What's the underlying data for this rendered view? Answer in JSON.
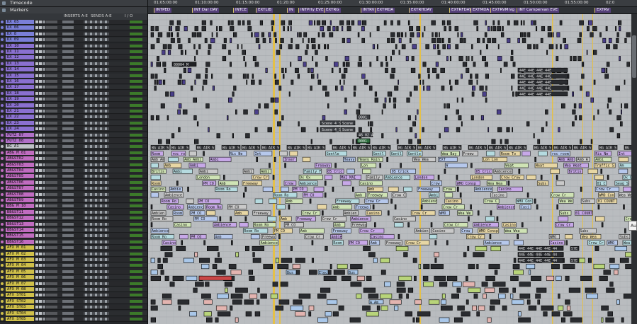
{
  "header": {
    "timecode_label": "Timecode",
    "markers_label": "Markers"
  },
  "columns": {
    "inserts": "INSERTS A-E",
    "sends": "SENDS A-E",
    "io": "I / O"
  },
  "ruler_times": [
    "01:05:00:00",
    "01:10:00:00",
    "01:15:00:00",
    "01:20:00",
    "01:25:00:00",
    "01:30:00:00",
    "01:35:00:00",
    "01:40:00:00",
    "01:45:00:00",
    "01:50:00:00",
    "01:55:00:00",
    "02:0"
  ],
  "markers": [
    "INTPED",
    "INT Dar DAY",
    "INTCE",
    "EXTLIB",
    "IN",
    "INTPrty EVE",
    "EXTRG",
    "INTRV",
    "EXTMDA",
    "EXTRHDAY",
    "EXTRFDAY",
    "EXTMDA",
    "EXTRVMnig",
    "INT Campervan EVE",
    "EXTRV"
  ],
  "tracks": [
    {
      "name": "DX 05",
      "color": "#7a7fd8"
    },
    {
      "name": "DX 06",
      "color": "#7a7fd8"
    },
    {
      "name": "DX 8",
      "color": "#7a7fd8"
    },
    {
      "name": "DX 09",
      "color": "#7a7fd8"
    },
    {
      "name": "DX 10",
      "color": "#8a70d0"
    },
    {
      "name": "DX 11",
      "color": "#8a70d0"
    },
    {
      "name": "DX 12",
      "color": "#8a70d0"
    },
    {
      "name": "DX 13",
      "color": "#8a70d0"
    },
    {
      "name": "DX 14",
      "color": "#8a70d0"
    },
    {
      "name": "DX 15",
      "color": "#8a70d0"
    },
    {
      "name": "DX 16",
      "color": "#8a70d0"
    },
    {
      "name": "DX 17",
      "color": "#8a70d0"
    },
    {
      "name": "DX 18",
      "color": "#8a70d0"
    },
    {
      "name": "DX 19",
      "color": "#8a70d0"
    },
    {
      "name": "DX 20",
      "color": "#8a70d0"
    },
    {
      "name": "DX 21",
      "color": "#8a70d0"
    },
    {
      "name": "DX 22",
      "color": "#8a70d0"
    },
    {
      "name": "DX 23",
      "color": "#8a70d0"
    },
    {
      "name": "DX 24",
      "color": "#8a70d0"
    },
    {
      "name": "FUTZ 07",
      "color": "#b070c8"
    },
    {
      "name": "FUTZ 08",
      "color": "#b070c8"
    },
    {
      "name": "BG A1",
      "color": "#bfc3c8"
    },
    {
      "name": "ABG M 01",
      "color": "#c06cc0"
    },
    {
      "name": "ABGST02",
      "color": "#c06cc0"
    },
    {
      "name": "ABGST03",
      "color": "#c06cc0"
    },
    {
      "name": "ABGST04",
      "color": "#c06cc0"
    },
    {
      "name": "ABGST05",
      "color": "#c06cc0"
    },
    {
      "name": "ABGST06",
      "color": "#c06cc0"
    },
    {
      "name": "ABGST07",
      "color": "#c06cc0"
    },
    {
      "name": "ABGST08",
      "color": "#c06cc0"
    },
    {
      "name": "ABGST09",
      "color": "#c06cc0"
    },
    {
      "name": "BBG M 10",
      "color": "#c06cc0"
    },
    {
      "name": "BBGST11",
      "color": "#c06cc0"
    },
    {
      "name": "BBGST12",
      "color": "#c06cc0"
    },
    {
      "name": "BBGST13",
      "color": "#c06cc0"
    },
    {
      "name": "BBGST14",
      "color": "#c06cc0"
    },
    {
      "name": "BBGST15",
      "color": "#c06cc0"
    },
    {
      "name": "BBGST16",
      "color": "#c06cc0"
    },
    {
      "name": "AFX M 01",
      "color": "#d0c04a"
    },
    {
      "name": "AFX M 02",
      "color": "#d0c04a"
    },
    {
      "name": "AFX M 03",
      "color": "#d0c04a"
    },
    {
      "name": "AFX M 04",
      "color": "#d0c04a"
    },
    {
      "name": "AFX M 05",
      "color": "#d0c04a"
    },
    {
      "name": "AFX M 06",
      "color": "#d0c04a"
    },
    {
      "name": "AFX M 07",
      "color": "#d0c04a"
    },
    {
      "name": "AFX M 08",
      "color": "#d0c04a"
    },
    {
      "name": "AFX ST01",
      "color": "#d0c04a"
    },
    {
      "name": "AFX ST02",
      "color": "#d0c04a"
    },
    {
      "name": "AFX ST03",
      "color": "#d0c04a"
    },
    {
      "name": "AFX ST04",
      "color": "#d0c04a"
    },
    {
      "name": "AFX ST05",
      "color": "#d0c04a"
    }
  ],
  "clip_labels": {
    "dx_counter": "00004 M",
    "scene_a": "Scene 4_St",
    "scene_b": "Scene 4_St",
    "scene_c": "Scene",
    "scene_d": "Scene",
    "code_1": "0001",
    "code_2": "46 02 A",
    "code_3": "0001",
    "code_4": "0001",
    "bg_header": "BG AIR 5",
    "bg_row_a": [
      "Room To",
      "roc_room_tone_a",
      "Ric Ne",
      "Int",
      "Gentle",
      "Gentle",
      "Gentle",
      "Gentle",
      "Wea Bay",
      "Freew"
    ],
    "bg_row_b": [
      "Lon Lon",
      "Amb Ambi Ambi",
      "Amb Ambi",
      "Ambi",
      "Insert C",
      "Heavy Rain",
      "Heavy Rain",
      "Wea Wea",
      "EXT"
    ],
    "bg_row_c": [
      "Traffic St",
      "Am",
      "Amb",
      "Ambi",
      "Freeway",
      "Lon",
      "W",
      "Weat",
      "Weat",
      "Wea Weat"
    ],
    "bg_row_d": [
      "British B",
      "Ambi",
      "Ambi",
      "Ambi",
      "Ambi",
      "Family Fam",
      "05 Crick",
      "05 Crick",
      "05 Crick",
      "Ambience"
    ],
    "bg_row_e": [
      "London",
      "London",
      "Crow Crow",
      "Ox Ox",
      "MAI MAI",
      "Family Fam",
      "Ambience"
    ],
    "bbg_rows": [
      "Casino",
      "Ambience",
      "Room Ro",
      "PM CO",
      "Amb",
      "Freeway",
      "Crow Cr",
      "Ambience",
      "Casino",
      "Crow Cr",
      "WMO Consp",
      "Wea Wea",
      "Subs",
      "01 COUNT",
      "Seag Seag",
      "Casino",
      "344 Aud"
    ],
    "afx": [
      "44E 44E 44E 44E 44",
      "57E",
      "44E 44E 44E 44E 44",
      "57E",
      "Bus",
      "Bus",
      "Elect",
      "Ex",
      "A Am"
    ]
  },
  "tooltip": "Au"
}
